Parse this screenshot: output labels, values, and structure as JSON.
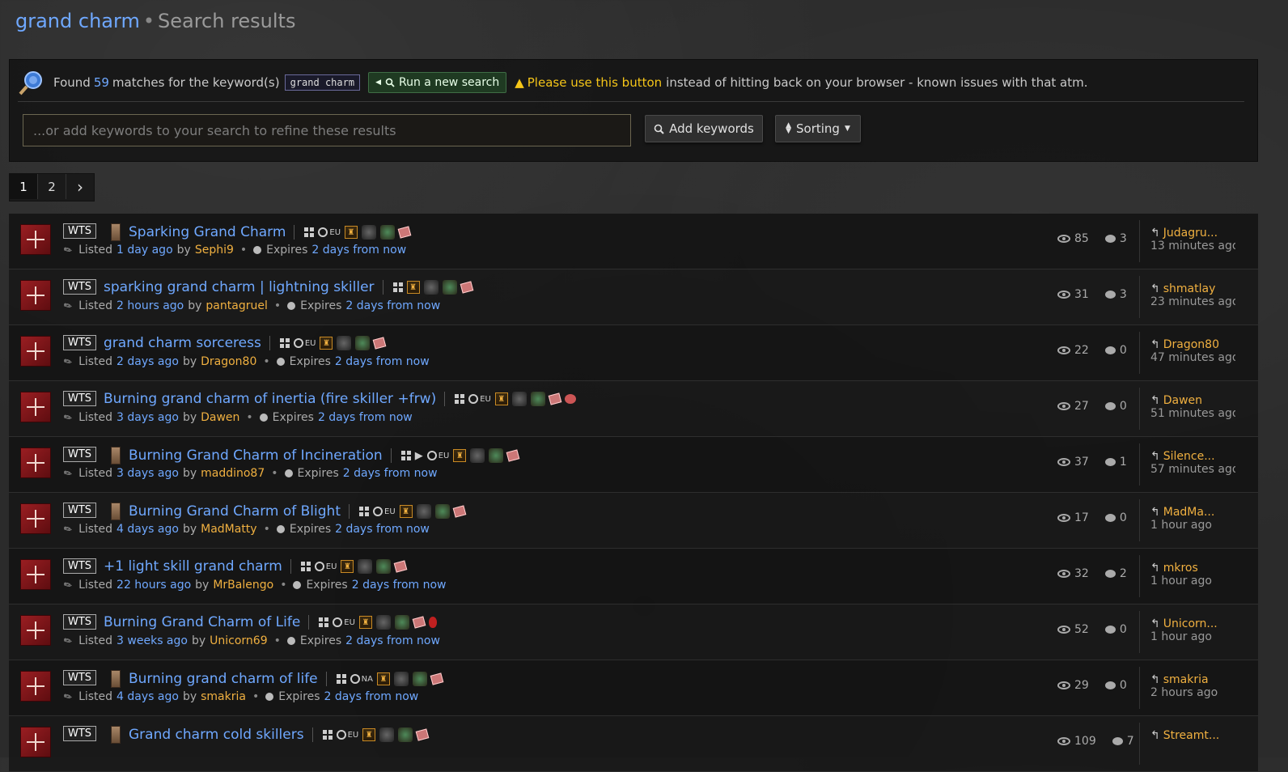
{
  "header": {
    "keyword": "grand charm",
    "separator": "•",
    "title": "Search results"
  },
  "search": {
    "found_prefix": "Found",
    "count": "59",
    "found_suffix": "matches for the keyword(s)",
    "keyword_code": "grand charm",
    "run_new_search": "Run a new search",
    "warning_highlight": "Please use this button",
    "warning_text": "instead of hitting back on your browser - known issues with that atm.",
    "refine_placeholder": "...or add keywords to your search to refine these results",
    "add_keywords": "Add keywords",
    "sorting": "Sorting"
  },
  "pagination": {
    "pages": [
      "1",
      "2"
    ],
    "next": "›"
  },
  "labels": {
    "listed": "Listed",
    "by": "by",
    "expires": "Expires",
    "wts": "WTS"
  },
  "listings": [
    {
      "title": "Sparking Grand Charm",
      "has_image": true,
      "tags": [
        "win",
        "region",
        "ladder",
        "hc",
        "class",
        "gift"
      ],
      "region": "EU",
      "ago": "1 day ago",
      "user": "Sephi9",
      "expires": "2 days from now",
      "views": "85",
      "replies": "3",
      "last_user": "Judagru...",
      "last_time": "13 minutes ago"
    },
    {
      "title": "sparking grand charm | lightning skiller",
      "has_image": false,
      "tags": [
        "win",
        "ladder",
        "hc",
        "class",
        "gift"
      ],
      "region": "",
      "ago": "2 hours ago",
      "user": "pantagruel",
      "expires": "2 days from now",
      "views": "31",
      "replies": "3",
      "last_user": "shmatlay",
      "last_time": "23 minutes ago"
    },
    {
      "title": "grand charm sorceress",
      "has_image": false,
      "tags": [
        "win",
        "region",
        "ladder",
        "hc",
        "class",
        "gift"
      ],
      "region": "EU",
      "ago": "2 days ago",
      "user": "Dragon80",
      "expires": "2 days from now",
      "views": "22",
      "replies": "0",
      "last_user": "Dragon80",
      "last_time": "47 minutes ago"
    },
    {
      "title": "Burning grand charm of inertia (fire skiller +frw)",
      "has_image": false,
      "tags": [
        "win",
        "region",
        "ladder",
        "hc",
        "class",
        "gift",
        "misc"
      ],
      "region": "EU",
      "ago": "3 days ago",
      "user": "Dawen",
      "expires": "2 days from now",
      "views": "27",
      "replies": "0",
      "last_user": "Dawen",
      "last_time": "51 minutes ago"
    },
    {
      "title": "Burning Grand Charm of Incineration",
      "has_image": true,
      "tags": [
        "win",
        "ps",
        "region",
        "ladder",
        "hc",
        "class",
        "gift"
      ],
      "region": "EU",
      "ago": "3 days ago",
      "user": "maddino87",
      "expires": "2 days from now",
      "views": "37",
      "replies": "1",
      "last_user": "Silence...",
      "last_time": "57 minutes ago"
    },
    {
      "title": "Burning Grand Charm of Blight",
      "has_image": true,
      "tags": [
        "win",
        "region",
        "ladder",
        "hc",
        "class",
        "gift"
      ],
      "region": "EU",
      "ago": "4 days ago",
      "user": "MadMatty",
      "expires": "2 days from now",
      "views": "17",
      "replies": "0",
      "last_user": "MadMa...",
      "last_time": "1 hour ago"
    },
    {
      "title": "+1 light skill grand charm",
      "has_image": false,
      "tags": [
        "win",
        "region",
        "ladder",
        "hc",
        "class",
        "gift"
      ],
      "region": "EU",
      "ago": "22 hours ago",
      "user": "MrBalengo",
      "expires": "2 days from now",
      "views": "32",
      "replies": "2",
      "last_user": "mkros",
      "last_time": "1 hour ago"
    },
    {
      "title": "Burning Grand Charm of Life",
      "has_image": false,
      "tags": [
        "win",
        "region",
        "ladder",
        "hc",
        "class",
        "gift",
        "red"
      ],
      "region": "EU",
      "ago": "3 weeks ago",
      "user": "Unicorn69",
      "expires": "2 days from now",
      "views": "52",
      "replies": "0",
      "last_user": "Unicorn...",
      "last_time": "1 hour ago"
    },
    {
      "title": "Burning grand charm of life",
      "has_image": true,
      "tags": [
        "win",
        "region",
        "ladder",
        "hc",
        "class",
        "gift"
      ],
      "region": "NA",
      "ago": "4 days ago",
      "user": "smakria",
      "expires": "2 days from now",
      "views": "29",
      "replies": "0",
      "last_user": "smakria",
      "last_time": "2 hours ago"
    },
    {
      "title": "Grand charm cold skillers",
      "has_image": true,
      "tags": [
        "win",
        "region",
        "ladder",
        "hc",
        "class",
        "gift"
      ],
      "region": "EU",
      "ago": "",
      "user": "",
      "expires": "",
      "views": "109",
      "replies": "7",
      "last_user": "Streamt...",
      "last_time": ""
    }
  ]
}
